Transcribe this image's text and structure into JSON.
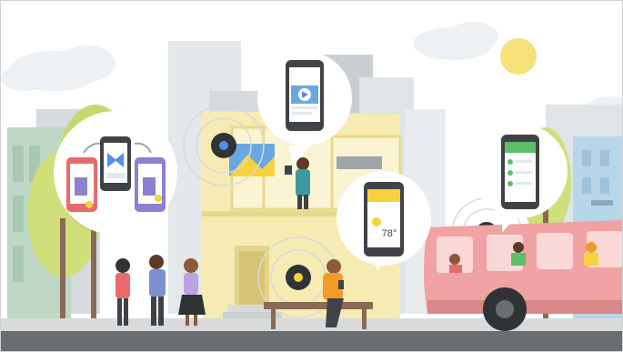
{
  "scene": {
    "weather_reading": "78°",
    "colors": {
      "sky": "#ffffff",
      "pale_buildings": "#e3e8ea",
      "gray_buildings": "#c9ced2",
      "green_building": "#bfd8c6",
      "blue_building": "#b7d6e8",
      "house": "#f6ebb3",
      "house_dark": "#e8d98a",
      "bus": "#f1a2a2",
      "bus_dark": "#d98787",
      "road": "#6b6e70",
      "sidewalk": "#d8dadb",
      "tree": "#cfe07a",
      "tree_trunk": "#8a6a55",
      "sun": "#f6e27a",
      "bubble": "#ffffff",
      "phone": "#3f4347",
      "screen": "#ffffff",
      "accent_blue": "#4f8ef2",
      "accent_yellow": "#f6d23c",
      "accent_green": "#5cbf6a",
      "accent_purple": "#8e7fd0",
      "accent_red": "#e86a6a",
      "beacon": "#2f3336"
    },
    "icons": [
      "play-icon",
      "sun-icon",
      "share-icon",
      "beacon-icon"
    ]
  }
}
